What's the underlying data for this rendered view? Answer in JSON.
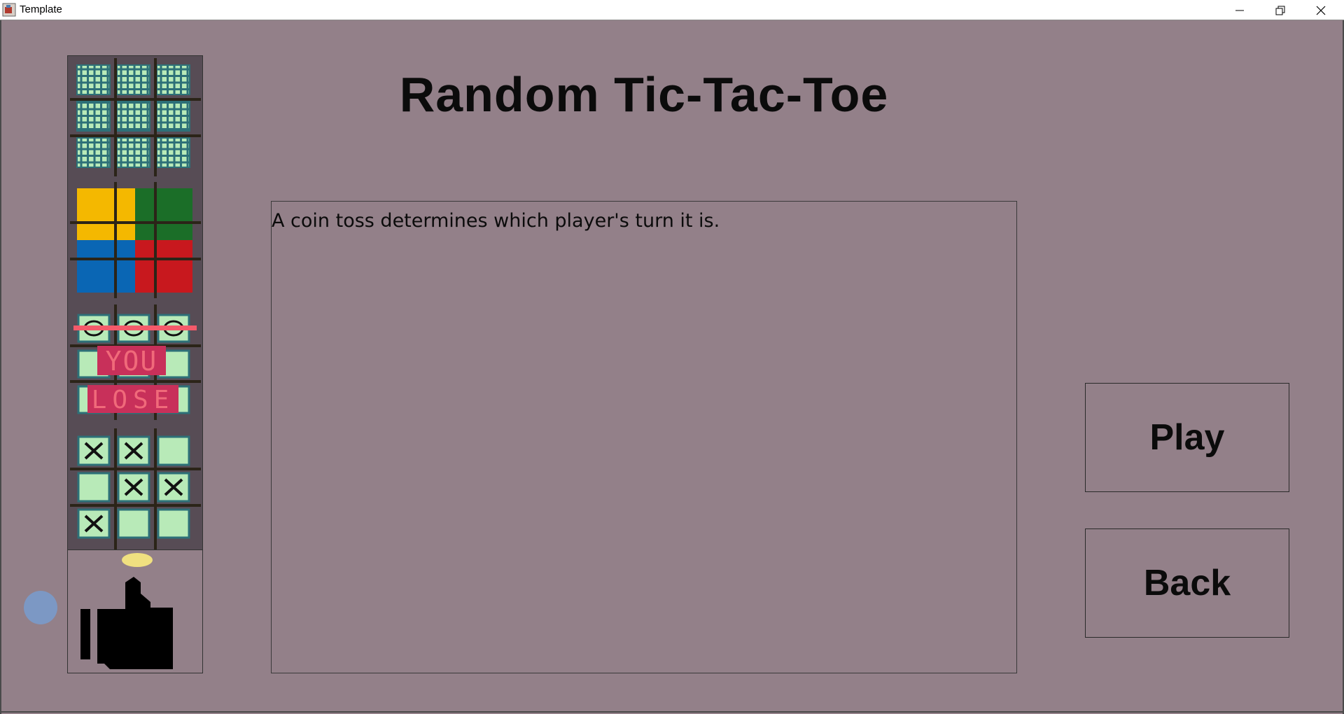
{
  "window": {
    "title": "Template",
    "controls": [
      "minimize",
      "restore",
      "close"
    ]
  },
  "main": {
    "title": "Random Tic-Tac-Toe",
    "description": "A coin toss determines which player's turn it is."
  },
  "buttons": {
    "play_label": "Play",
    "back_label": "Back"
  },
  "preview": {
    "game_over_banner": [
      "YOU",
      "LOSE"
    ]
  },
  "colors": {
    "background": "#938089",
    "strip": "#574c55",
    "cell": "#b8eab8",
    "cell_border": "#3a8a92",
    "grid_line": "#2b2418",
    "yellow": "#f4b800",
    "green": "#1b6e28",
    "blue": "#0a66b4",
    "red": "#c8181e",
    "lose_banner": "#c8305a",
    "coin": "#f0e080",
    "dot": "#7c98c4"
  }
}
